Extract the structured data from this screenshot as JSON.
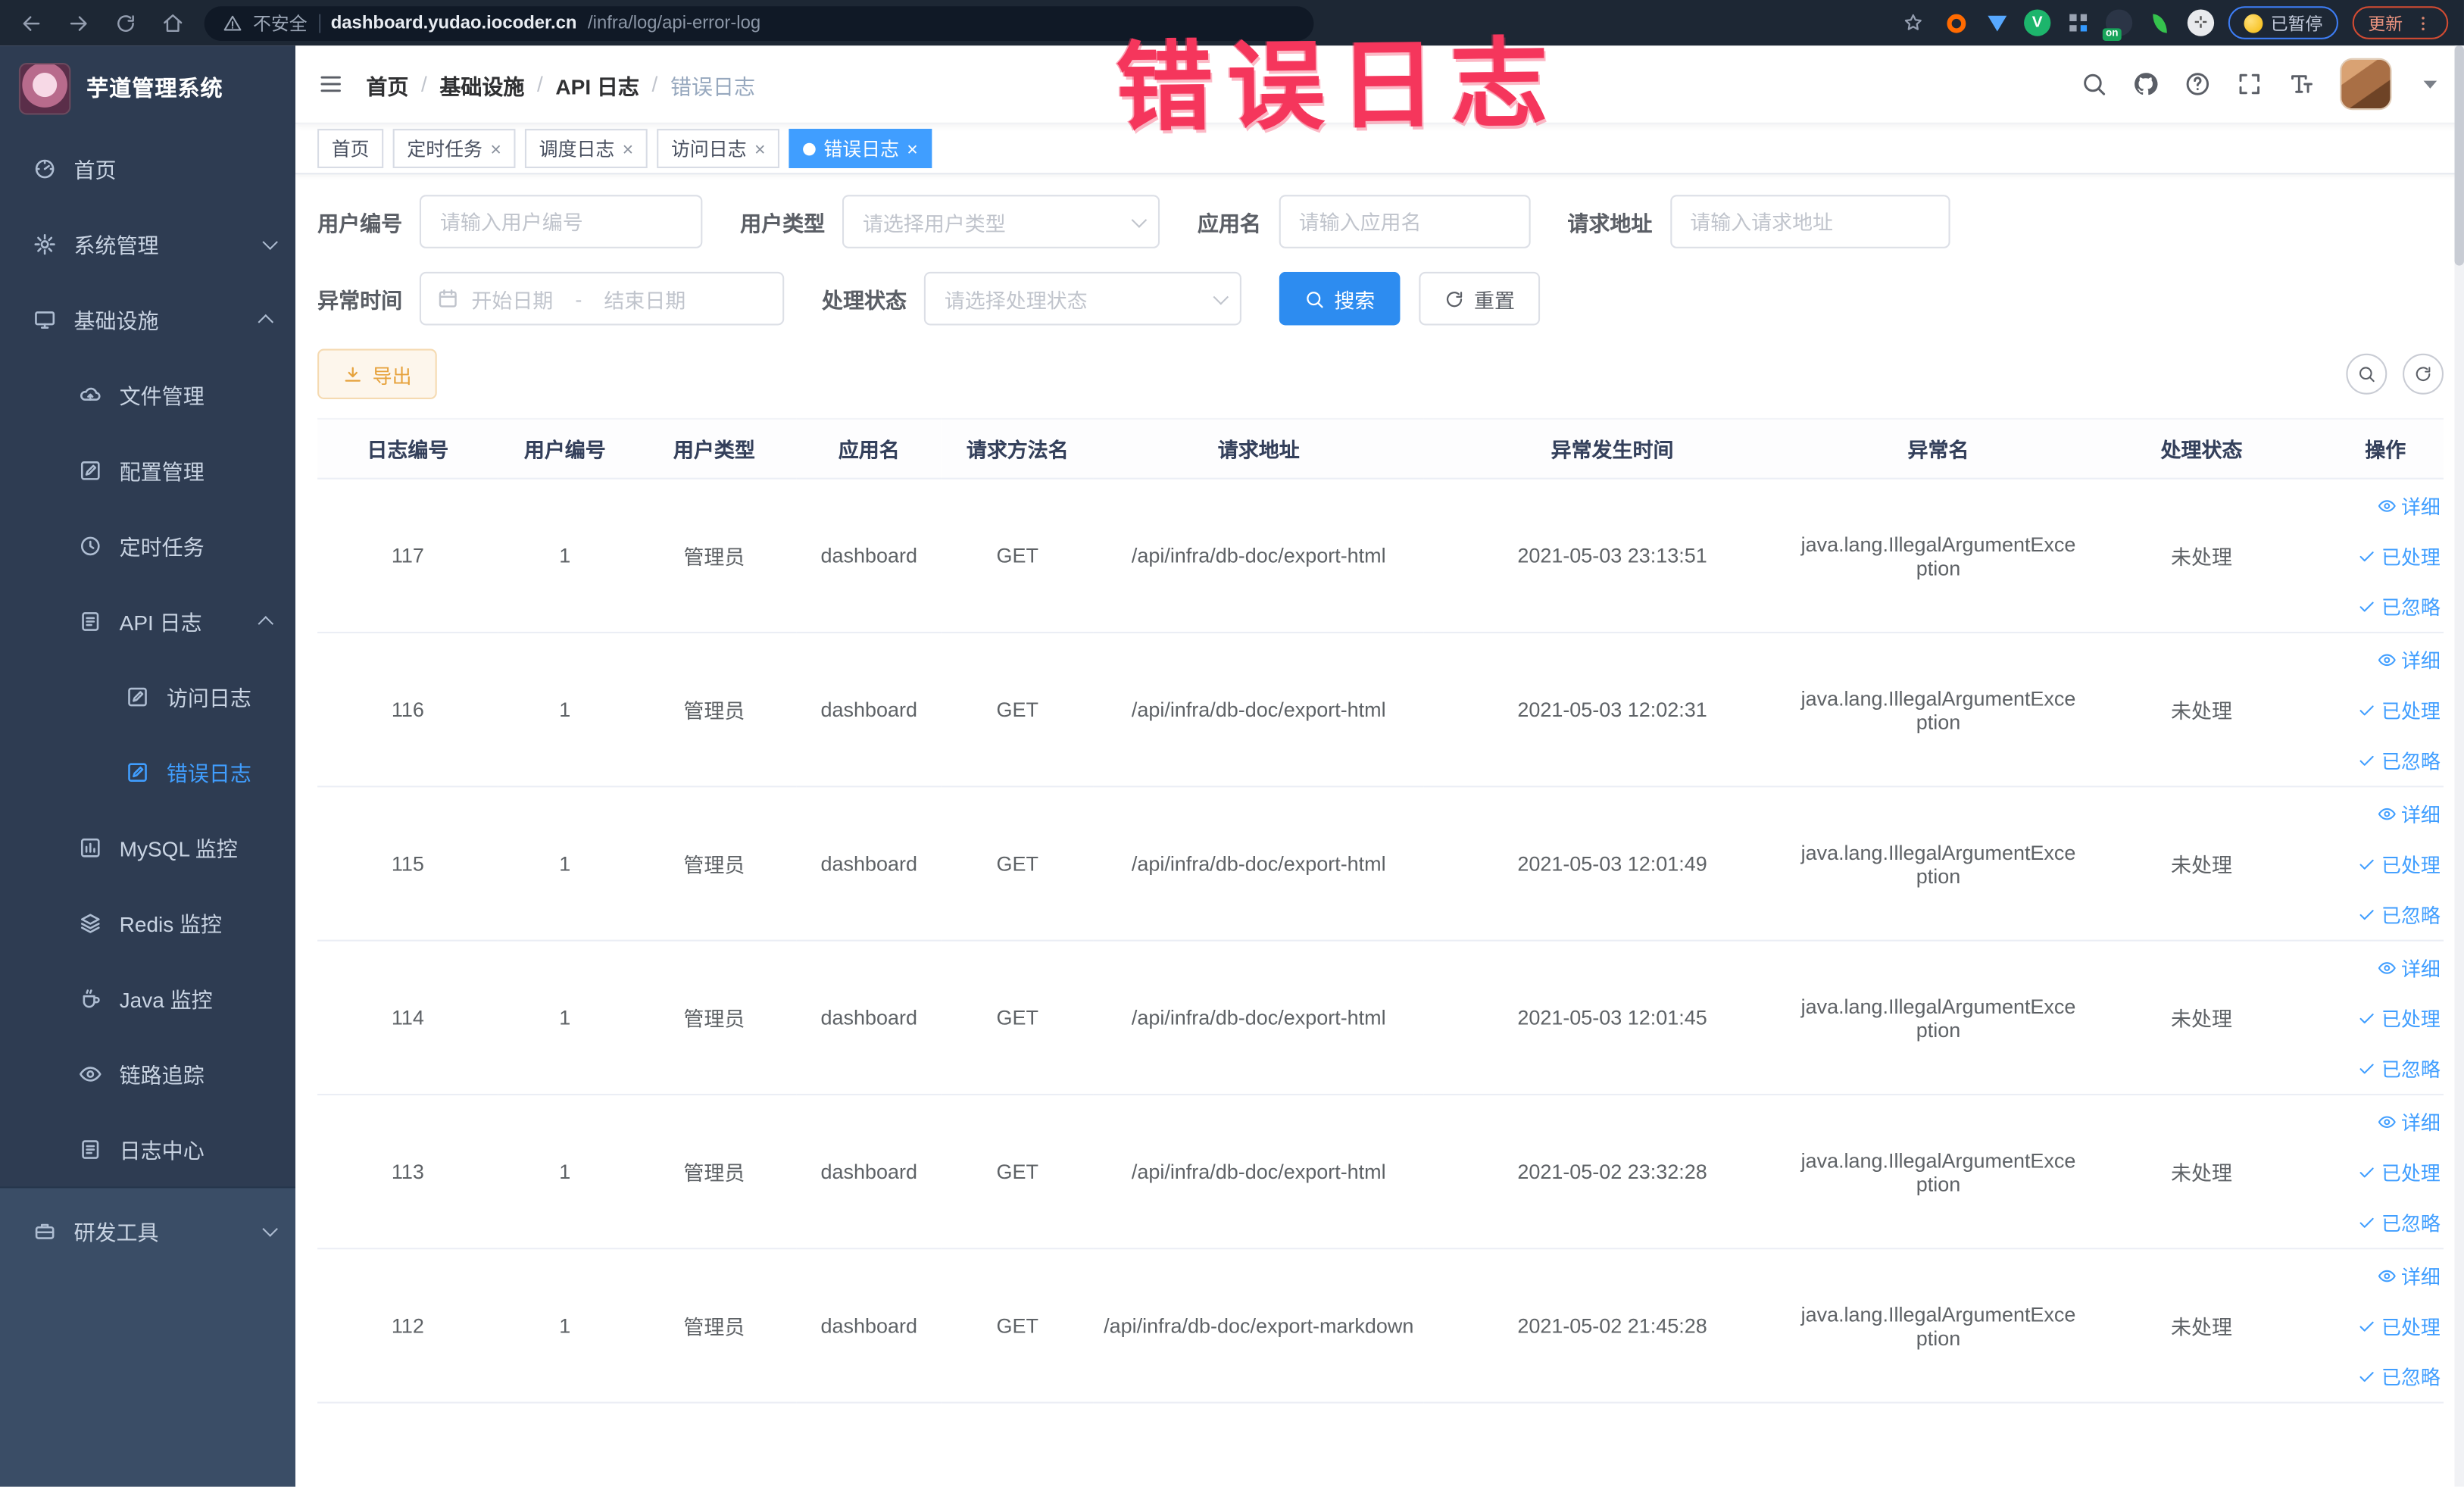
{
  "browser": {
    "security_label": "不安全",
    "url_host": "dashboard.yudao.iocoder.cn",
    "url_path": "/infra/log/api-error-log",
    "extensions": [
      {
        "name": "ext-orange-ring",
        "kind": "ring",
        "color": "#ff6a00"
      },
      {
        "name": "ext-blue-shield",
        "kind": "tri",
        "color": "#57a8ff"
      },
      {
        "name": "ext-green-v",
        "kind": "disc",
        "color": "#1db56c",
        "text": "V"
      },
      {
        "name": "ext-grid",
        "kind": "grid",
        "color": "#9aa3b2"
      },
      {
        "name": "ext-on-switch",
        "kind": "disc",
        "color": "#2b3546",
        "badge": "on"
      },
      {
        "name": "ext-green-leaf",
        "kind": "leaf",
        "color": "#35c24d"
      },
      {
        "name": "ext-puzzle",
        "kind": "disc",
        "color": "#e8eaed",
        "text": "⊹"
      }
    ],
    "paused_label": "已暂停",
    "update_label": "更新"
  },
  "sidebar": {
    "title": "芋道管理系统",
    "items": [
      {
        "name": "home",
        "label": "首页",
        "icon": "gauge",
        "level": 1
      },
      {
        "name": "system",
        "label": "系统管理",
        "icon": "gear",
        "level": 1,
        "chevron": "down"
      },
      {
        "name": "infra",
        "label": "基础设施",
        "icon": "monitor",
        "level": 1,
        "chevron": "up"
      },
      {
        "name": "file-manage",
        "label": "文件管理",
        "icon": "cloud",
        "level": 2
      },
      {
        "name": "config-manage",
        "label": "配置管理",
        "icon": "edit",
        "level": 2
      },
      {
        "name": "scheduled-job",
        "label": "定时任务",
        "icon": "clock",
        "level": 2
      },
      {
        "name": "api-log",
        "label": "API 日志",
        "icon": "doc",
        "level": 2,
        "chevron": "up"
      },
      {
        "name": "access-log",
        "label": "访问日志",
        "icon": "edit",
        "level": 3
      },
      {
        "name": "error-log",
        "label": "错误日志",
        "icon": "edit",
        "level": 3,
        "active": true
      },
      {
        "name": "mysql-monitor",
        "label": "MySQL 监控",
        "icon": "chart",
        "level": 2
      },
      {
        "name": "redis-monitor",
        "label": "Redis 监控",
        "icon": "layers",
        "level": 2
      },
      {
        "name": "java-monitor",
        "label": "Java 监控",
        "icon": "cup",
        "level": 2
      },
      {
        "name": "trace",
        "label": "链路追踪",
        "icon": "eye",
        "level": 2
      },
      {
        "name": "log-center",
        "label": "日志中心",
        "icon": "doc",
        "level": 2
      },
      {
        "name": "dev-tools",
        "label": "研发工具",
        "icon": "toolbox",
        "level": 1,
        "chevron": "down",
        "section": "bottom"
      }
    ]
  },
  "navbar": {
    "breadcrumb": [
      "首页",
      "基础设施",
      "API 日志",
      "错误日志"
    ]
  },
  "tags": [
    {
      "name": "tag-home",
      "label": "首页",
      "closable": false,
      "active": false
    },
    {
      "name": "tag-job",
      "label": "定时任务",
      "closable": true,
      "active": false
    },
    {
      "name": "tag-job-log",
      "label": "调度日志",
      "closable": true,
      "active": false
    },
    {
      "name": "tag-access-log",
      "label": "访问日志",
      "closable": true,
      "active": false
    },
    {
      "name": "tag-error-log",
      "label": "错误日志",
      "closable": true,
      "active": true
    }
  ],
  "filters": {
    "user_id": {
      "label": "用户编号",
      "placeholder": "请输入用户编号"
    },
    "user_type": {
      "label": "用户类型",
      "placeholder": "请选择用户类型"
    },
    "app_name": {
      "label": "应用名",
      "placeholder": "请输入应用名"
    },
    "request_url": {
      "label": "请求地址",
      "placeholder": "请输入请求地址"
    },
    "time": {
      "label": "异常时间",
      "start": "开始日期",
      "separator": "-",
      "end": "结束日期"
    },
    "status": {
      "label": "处理状态",
      "placeholder": "请选择处理状态"
    },
    "search_label": "搜索",
    "reset_label": "重置"
  },
  "toolbar": {
    "export_label": "导出"
  },
  "table": {
    "columns": [
      {
        "key": "id",
        "label": "日志编号"
      },
      {
        "key": "user_id",
        "label": "用户编号"
      },
      {
        "key": "user_type",
        "label": "用户类型"
      },
      {
        "key": "app",
        "label": "应用名"
      },
      {
        "key": "method",
        "label": "请求方法名"
      },
      {
        "key": "url",
        "label": "请求地址"
      },
      {
        "key": "time",
        "label": "异常发生时间"
      },
      {
        "key": "exception",
        "label": "异常名"
      },
      {
        "key": "status",
        "label": "处理状态"
      },
      {
        "key": "ops",
        "label": "操作"
      }
    ],
    "rows": [
      {
        "id": "117",
        "user_id": "1",
        "user_type": "管理员",
        "app": "dashboard",
        "method": "GET",
        "url": "/api/infra/db-doc/export-html",
        "time": "2021-05-03 23:13:51",
        "exception": "java.lang.IllegalArgumentException",
        "status": "未处理"
      },
      {
        "id": "116",
        "user_id": "1",
        "user_type": "管理员",
        "app": "dashboard",
        "method": "GET",
        "url": "/api/infra/db-doc/export-html",
        "time": "2021-05-03 12:02:31",
        "exception": "java.lang.IllegalArgumentException",
        "status": "未处理"
      },
      {
        "id": "115",
        "user_id": "1",
        "user_type": "管理员",
        "app": "dashboard",
        "method": "GET",
        "url": "/api/infra/db-doc/export-html",
        "time": "2021-05-03 12:01:49",
        "exception": "java.lang.IllegalArgumentException",
        "status": "未处理"
      },
      {
        "id": "114",
        "user_id": "1",
        "user_type": "管理员",
        "app": "dashboard",
        "method": "GET",
        "url": "/api/infra/db-doc/export-html",
        "time": "2021-05-03 12:01:45",
        "exception": "java.lang.IllegalArgumentException",
        "status": "未处理"
      },
      {
        "id": "113",
        "user_id": "1",
        "user_type": "管理员",
        "app": "dashboard",
        "method": "GET",
        "url": "/api/infra/db-doc/export-html",
        "time": "2021-05-02 23:32:28",
        "exception": "java.lang.IllegalArgumentException",
        "status": "未处理"
      },
      {
        "id": "112",
        "user_id": "1",
        "user_type": "管理员",
        "app": "dashboard",
        "method": "GET",
        "url": "/api/infra/db-doc/export-markdown",
        "time": "2021-05-02 21:45:28",
        "exception": "java.lang.IllegalArgumentException",
        "status": "未处理"
      }
    ],
    "row_actions": [
      {
        "name": "detail",
        "icon": "eye",
        "label": "详细"
      },
      {
        "name": "processed",
        "icon": "check",
        "label": "已处理"
      },
      {
        "name": "ignored",
        "icon": "check",
        "label": "已忽略"
      }
    ]
  },
  "annotation": {
    "text": "错误日志"
  },
  "colors": {
    "accent": "#409eff",
    "search_button": "#2d8cf0",
    "export_warning": "#e6a23c",
    "annotation_red": "#f5365c",
    "sidebar_bg": "#2e3c52",
    "sidebar_bottom_bg": "#3a4d66",
    "chrome_bg": "#1d2734"
  }
}
